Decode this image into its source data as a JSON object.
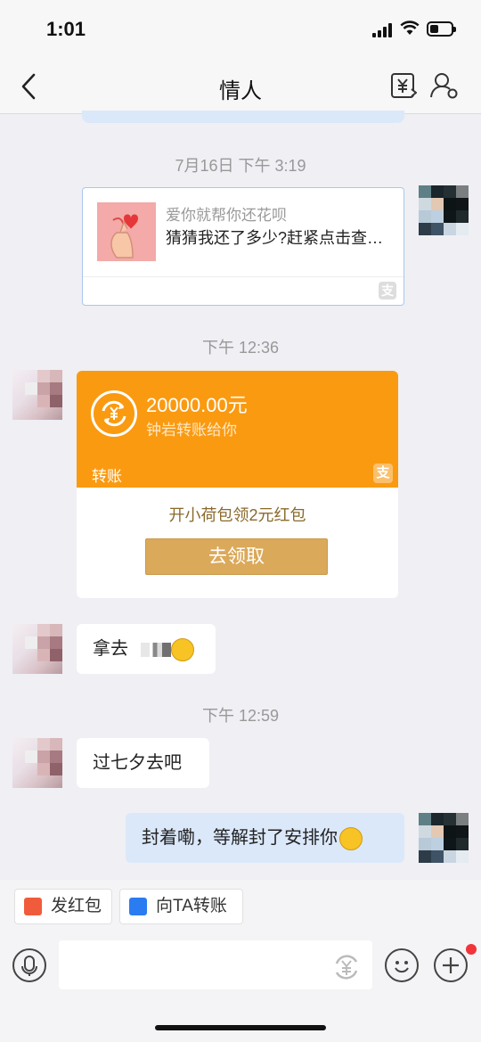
{
  "status_bar": {
    "time": "1:01"
  },
  "nav": {
    "title": "情人",
    "back_icon": "chevron-left-icon",
    "transfer_icon": "yuan-transfer-icon",
    "profile_icon": "person-settings-icon"
  },
  "messages": {
    "ts1": "7月16日 下午 3:19",
    "link_card": {
      "title": "爱你就帮你还花呗",
      "desc": "猜猜我还了多少?赶紧点击查…"
    },
    "ts2": "下午 12:36",
    "transfer": {
      "amount": "20000.00元",
      "desc": "钟岩转账给你",
      "label": "转账",
      "promo": "开小荷包领2元红包",
      "button": "去领取"
    },
    "msg1": "拿去",
    "ts3": "下午 12:59",
    "msg2": "过七夕去吧",
    "msg3": "封着嘞，等解封了安排你"
  },
  "quick_actions": {
    "red_packet": "发红包",
    "transfer": "向TA转账"
  },
  "input": {
    "placeholder": ""
  },
  "colors": {
    "accent_orange": "#fa9a10",
    "claim_gold": "#dba95a",
    "my_bubble": "#dbe8fa",
    "notification_red": "#f2333a"
  }
}
